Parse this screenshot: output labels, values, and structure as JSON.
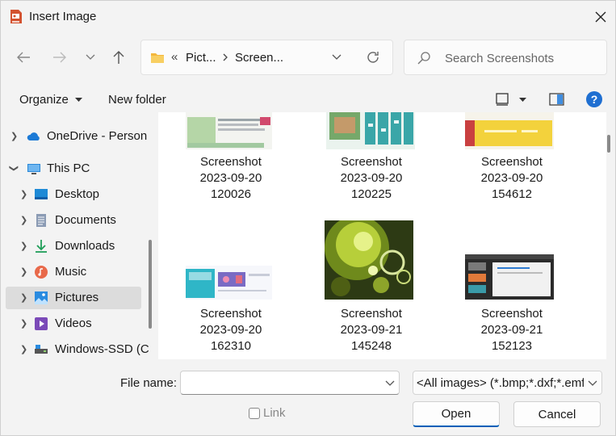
{
  "window": {
    "title": "Insert Image"
  },
  "address": {
    "crumbs": [
      "Pict...",
      "Screen..."
    ],
    "overflow": "«"
  },
  "search": {
    "placeholder": "Search Screenshots"
  },
  "toolbar": {
    "organize": "Organize",
    "new_folder": "New folder"
  },
  "sidebar": {
    "items": [
      {
        "label": "OneDrive - Person"
      },
      {
        "label": "This PC"
      },
      {
        "label": "Desktop"
      },
      {
        "label": "Documents"
      },
      {
        "label": "Downloads"
      },
      {
        "label": "Music"
      },
      {
        "label": "Pictures"
      },
      {
        "label": "Videos"
      },
      {
        "label": "Windows-SSD (C"
      }
    ]
  },
  "files": [
    {
      "line1": "Screenshot",
      "line2": "2023-09-20",
      "line3": "120026"
    },
    {
      "line1": "Screenshot",
      "line2": "2023-09-20",
      "line3": "120225"
    },
    {
      "line1": "Screenshot",
      "line2": "2023-09-20",
      "line3": "154612"
    },
    {
      "line1": "Screenshot",
      "line2": "2023-09-20",
      "line3": "162310"
    },
    {
      "line1": "Screenshot",
      "line2": "2023-09-21",
      "line3": "145248"
    },
    {
      "line1": "Screenshot",
      "line2": "2023-09-21",
      "line3": "152123"
    }
  ],
  "bottom": {
    "file_name_label": "File name:",
    "file_name_value": "",
    "filter": "<All images> (*.bmp;*.dxf;*.emf",
    "link_label": "Link",
    "open_label": "Open",
    "cancel_label": "Cancel"
  },
  "colors": {
    "accent": "#005fb8",
    "help": "#1f6fd1",
    "folder": "#f4b73c"
  }
}
